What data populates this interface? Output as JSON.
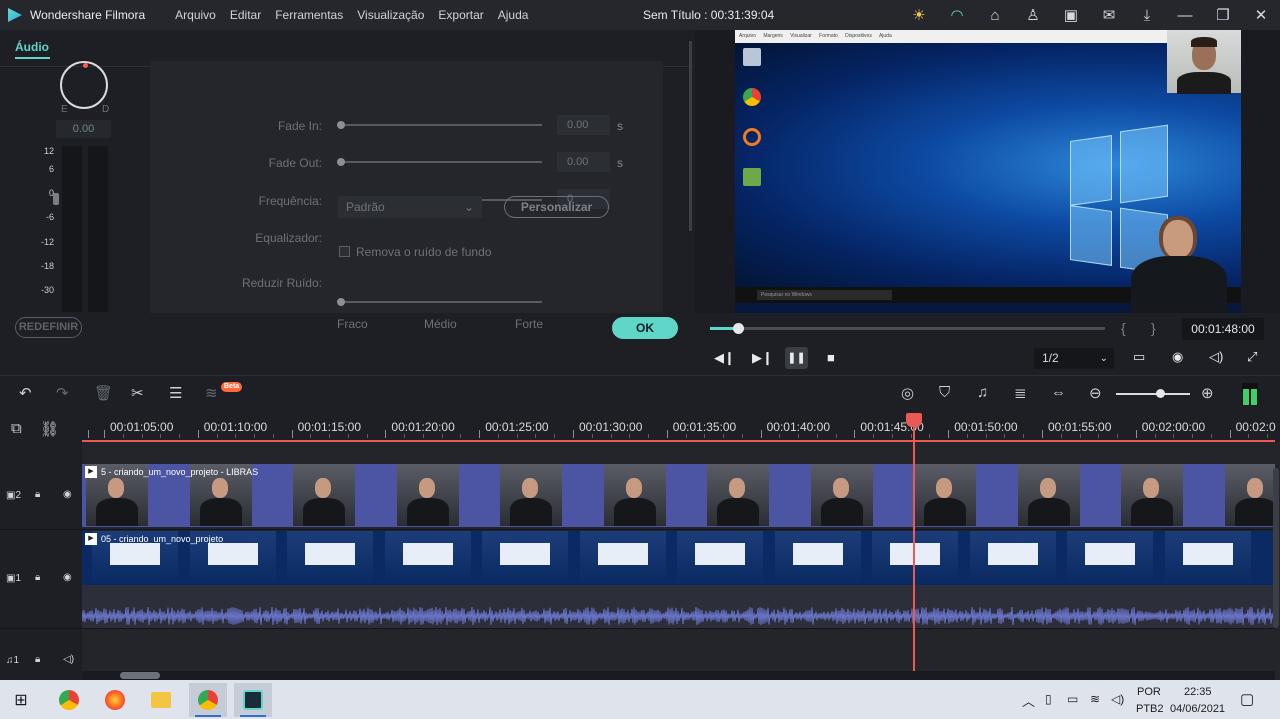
{
  "app": {
    "name": "Wondershare Filmora",
    "title": "Sem Título : 00:31:39:04"
  },
  "menu": [
    "Arquivo",
    "Editar",
    "Ferramentas",
    "Visualização",
    "Exportar",
    "Ajuda"
  ],
  "audio_panel": {
    "tab": "Áudio",
    "pan_left": "E",
    "pan_right": "D",
    "pan_value": "0.00",
    "meter_scale": [
      "12",
      "6",
      "0",
      "-6",
      "-12",
      "-18",
      "-30"
    ],
    "fade_in_label": "Fade In:",
    "fade_in_value": "0.00",
    "fade_out_label": "Fade Out:",
    "fade_out_value": "0.00",
    "unit_s": "s",
    "frequency_label": "Frequência:",
    "frequency_value": "0",
    "equalizer_label": "Equalizador:",
    "equalizer_value": "Padrão",
    "customize_button": "Personalizar",
    "noise_label": "Reduzir Ruído:",
    "noise_checkbox_label": "Remova o ruído de fundo",
    "noise_levels": [
      "Fraco",
      "Médio",
      "Forte"
    ],
    "reset_button": "REDEFINIR",
    "ok_button": "OK"
  },
  "preview": {
    "screen_menu": "Arquivo Margens Visualizar Formato Dispositivos Ajuda",
    "search_text": "Pesquisar no Windows",
    "progress": 0.07,
    "time": "00:01:48:00",
    "ratio": "1/2"
  },
  "toolbar": {
    "beta": "Beta",
    "zoom": 0.6
  },
  "ruler": [
    "00:01:05:00",
    "00:01:10:00",
    "00:01:15:00",
    "00:01:20:00",
    "00:01:25:00",
    "00:01:30:00",
    "00:01:35:00",
    "00:01:40:00",
    "00:01:45:00",
    "00:01:50:00",
    "00:01:55:00",
    "00:02:00:00",
    "00:02:0"
  ],
  "tracks": {
    "track2_label": "2",
    "track2_clip": "5 - criando_um_novo_projeto - LIBRAS",
    "track1_label": "1",
    "track1_clip": "05 - criando_um_novo_projeto",
    "audio_label": "1"
  },
  "taskbar": {
    "lang": "POR",
    "layout": "PTB2",
    "time": "22:35",
    "date": "04/06/2021"
  },
  "colors": {
    "accent": "#5fd6c7",
    "playhead": "#ea5a52",
    "clip": "#4c55a3"
  }
}
